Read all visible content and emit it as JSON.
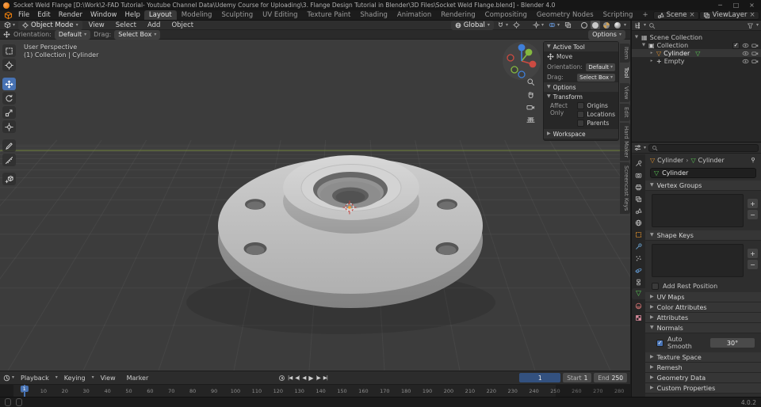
{
  "app": {
    "title": "Socket Weld Flange [D:\\Work\\2-FAD Tutorial- Youtube Channel Data\\Udemy Course for Uploading\\3. Flange Design Tutorial in Blender\\3D Files\\Socket Weld Flange.blend] - Blender 4.0",
    "version": "4.0.2"
  },
  "glyphs": {
    "minimize": "─",
    "maximize": "□",
    "close": "×",
    "dropdown": "▾",
    "panel_open": "▼",
    "panel_closed": "▶",
    "tree_open": "▼",
    "tree_closed": "▸",
    "check": "✓",
    "plus": "+",
    "minus": "−",
    "breadcrumb_sep": "›",
    "mesh": "▽",
    "collection": "▣",
    "scene_collection": "▦",
    "empty": "+",
    "jump_start": "|◀",
    "prev_key": "◀|",
    "play_reverse": "◀",
    "play": "▶",
    "next_key": "|▶",
    "jump_end": "▶|"
  },
  "menubar": {
    "menus": [
      "File",
      "Edit",
      "Render",
      "Window",
      "Help"
    ],
    "workspaces": [
      "Layout",
      "Modeling",
      "Sculpting",
      "UV Editing",
      "Texture Paint",
      "Shading",
      "Animation",
      "Rendering",
      "Compositing",
      "Geometry Nodes",
      "Scripting"
    ],
    "active_workspace": "Layout",
    "add_workspace": "+",
    "scene_name": "Scene",
    "view_layer_name": "ViewLayer"
  },
  "viewport": {
    "header": {
      "mode": "Object Mode",
      "menus": [
        "View",
        "Select",
        "Add",
        "Object"
      ],
      "transform_orientation": "Global"
    },
    "tool_settings": {
      "orientation_label": "Orientation:",
      "orientation_value": "Default",
      "drag_label": "Drag:",
      "drag_value": "Select Box",
      "options": "Options"
    },
    "overlay": {
      "view_name": "User Perspective",
      "context": "(1) Collection | Cylinder"
    },
    "tools": [
      "select-box",
      "cursor",
      "move",
      "rotate",
      "scale",
      "transform",
      "annotate",
      "measure",
      "add-primitive"
    ],
    "active_tool": "move"
  },
  "npanel": {
    "tabs": [
      "Item",
      "Tool",
      "View",
      "Edit",
      "Hard Maker",
      "Screencast Keys"
    ],
    "active_tab": "Tool",
    "sections": {
      "active_tool": "Active Tool",
      "tool_name": "Move",
      "orientation_label": "Orientation:",
      "orientation_value": "Default",
      "drag_label": "Drag:",
      "drag_value": "Select Box",
      "options": "Options",
      "transform": "Transform",
      "affect_only": "Affect Only",
      "affect_origins": "Origins",
      "affect_locations": "Locations",
      "affect_parents": "Parents",
      "workspace": "Workspace"
    }
  },
  "outliner": {
    "scene_collection": "Scene Collection",
    "collection": "Collection",
    "objects": [
      "Cylinder",
      "Empty"
    ],
    "selected_object": "Cylinder"
  },
  "properties": {
    "breadcrumb_object": "Cylinder",
    "breadcrumb_data": "Cylinder",
    "name_field": "Cylinder",
    "panels": {
      "vertex_groups": "Vertex Groups",
      "shape_keys": "Shape Keys",
      "add_rest_position": "Add Rest Position",
      "uv_maps": "UV Maps",
      "color_attributes": "Color Attributes",
      "attributes": "Attributes",
      "normals": "Normals",
      "texture_space": "Texture Space",
      "remesh": "Remesh",
      "geometry_data": "Geometry Data",
      "custom_properties": "Custom Properties"
    },
    "normals": {
      "auto_smooth_label": "Auto Smooth",
      "auto_smooth_checked": true,
      "auto_smooth_angle": "30°"
    }
  },
  "timeline": {
    "menus": [
      "Playback",
      "Keying",
      "View",
      "Marker"
    ],
    "current_frame": "1",
    "start_label": "Start",
    "start_value": "1",
    "end_label": "End",
    "end_value": "250",
    "ticks": [
      0,
      10,
      20,
      30,
      40,
      50,
      60,
      70,
      80,
      90,
      100,
      110,
      120,
      130,
      140,
      150,
      160,
      170,
      180,
      190,
      200,
      210,
      220,
      230,
      240,
      250,
      260,
      270,
      280
    ]
  },
  "colors": {
    "accent_blue": "#4772b3",
    "axis_x_red": "#cc4b42",
    "axis_y_green": "#84a43c",
    "axis_z_blue": "#3f7fd9",
    "data_green": "#58c554",
    "object_orange": "#e0902c"
  }
}
